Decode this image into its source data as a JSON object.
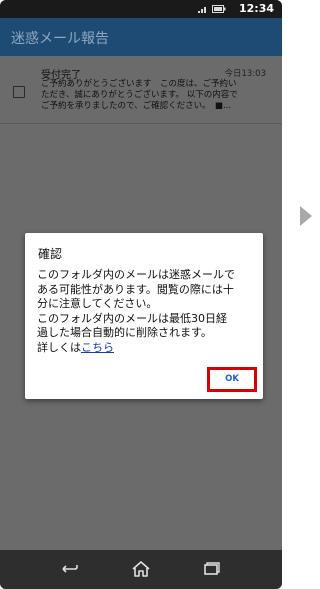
{
  "status_bar": {
    "time": "12:34",
    "icons": [
      "signal-icon",
      "battery-icon"
    ]
  },
  "app_bar": {
    "title": "迷惑メール報告"
  },
  "mail_list": [
    {
      "subject": "受付完了",
      "date": "今日13:03",
      "preview_lines": [
        "ご予約ありがとうございます　この度は、ご予約い",
        "ただき、誠にありがとうございます。 以下の内容で",
        "ご予約を承りましたので、ご確認ください。　■..."
      ],
      "checked": false
    }
  ],
  "dialog": {
    "title": "確認",
    "body_lines": [
      "このフォルダ内のメールは迷惑メールで",
      "ある可能性があります。閲覧の際には十",
      "分に注意してください。",
      "このフォルダ内のメールは最低30日経",
      "過した場合自動的に削除されます。"
    ],
    "link_prefix": "詳しくは",
    "link_text": "こちら",
    "ok_label": "OK"
  },
  "nav_bar": {
    "buttons": [
      "back-icon",
      "home-icon",
      "recent-apps-icon"
    ]
  },
  "colors": {
    "app_bar": "#1d4b74",
    "overlay_content": "#6b6b6b",
    "highlight": "#d50000",
    "link": "#1a3aa8"
  }
}
